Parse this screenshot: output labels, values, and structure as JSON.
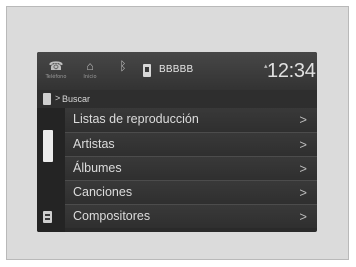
{
  "status_bar": {
    "icons": [
      {
        "name": "phone-icon",
        "glyph": "☎",
        "label": "Teléfono"
      },
      {
        "name": "home-icon",
        "glyph": "⌂",
        "label": "Inicio"
      },
      {
        "name": "bluetooth-icon",
        "glyph": "ᛒ",
        "label": ""
      }
    ],
    "device_name": "BBBBB",
    "clock": "12:34"
  },
  "breadcrumb": {
    "separator": ">",
    "label": "Buscar"
  },
  "list": {
    "items": [
      {
        "label": "Listas de reproducción",
        "chevron": ">"
      },
      {
        "label": "Artistas",
        "chevron": ">"
      },
      {
        "label": "Álbumes",
        "chevron": ">"
      },
      {
        "label": "Canciones",
        "chevron": ">"
      },
      {
        "label": "Compositores",
        "chevron": ">"
      }
    ]
  }
}
